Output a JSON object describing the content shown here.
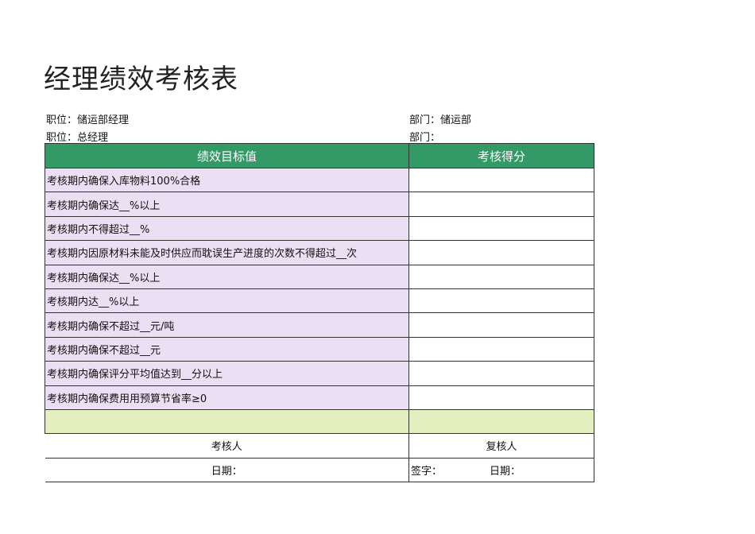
{
  "title": "经理绩效考核表",
  "info": {
    "position1": "职位：储运部经理",
    "dept1": "部门：储运部",
    "position2": "职位：总经理",
    "dept2": "部门："
  },
  "table": {
    "headers": [
      "绩效目标值",
      "考核得分"
    ],
    "rows": [
      "考核期内确保入库物料100%合格",
      "考核期内确保达__%以上",
      "考核期内不得超过__%",
      "考核期内因原材料未能及时供应而耽误生产进度的次数不得超过__次",
      "考核期内确保达__%以上",
      "考核期内达__%以上",
      "考核期内确保不超过__元/吨",
      "考核期内确保不超过__元",
      "考核期内确保评分平均值达到__分以上",
      "考核期内确保费用用预算节省率≥0"
    ]
  },
  "footer": {
    "assessor": "考核人",
    "reviewer": "复核人",
    "date_left": "日期：",
    "sign": "签字：",
    "date_right": "日期："
  }
}
